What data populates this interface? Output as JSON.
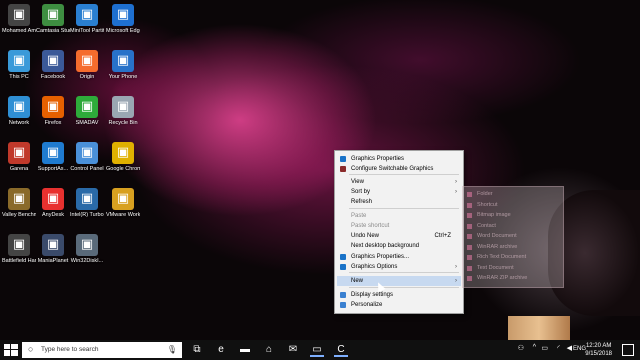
{
  "desktop": {
    "icons": [
      {
        "label": "Mohamed Amr Diaay",
        "icon": "user-folder-icon",
        "color": "#444444"
      },
      {
        "label": "Camtasia Studio 8",
        "icon": "camtasia-icon",
        "color": "#3e8e41"
      },
      {
        "label": "MiniTool Partition...",
        "icon": "minitool-icon",
        "color": "#2a7fd1"
      },
      {
        "label": "Microsoft Edge",
        "icon": "edge-icon",
        "color": "#1e6fd0"
      },
      {
        "label": "This PC",
        "icon": "computer-icon",
        "color": "#3a9ad9"
      },
      {
        "label": "Facebook",
        "icon": "facebook-icon",
        "color": "#3b5998"
      },
      {
        "label": "Origin",
        "icon": "origin-icon",
        "color": "#f56c2d"
      },
      {
        "label": "Your Phone",
        "icon": "phone-icon",
        "color": "#2872c9"
      },
      {
        "label": "Network",
        "icon": "network-icon",
        "color": "#2f8fd4"
      },
      {
        "label": "Firefox",
        "icon": "firefox-icon",
        "color": "#e66000"
      },
      {
        "label": "SMADAV",
        "icon": "smadav-icon",
        "color": "#2eaa3a"
      },
      {
        "label": "Recycle Bin",
        "icon": "recycle-bin-icon",
        "color": "#9aa6b2"
      },
      {
        "label": "Garena",
        "icon": "garena-icon",
        "color": "#c0392b"
      },
      {
        "label": "SupportAs...",
        "icon": "support-assist-icon",
        "color": "#1f7bd0"
      },
      {
        "label": "Control Panel",
        "icon": "control-panel-icon",
        "color": "#4a90d9"
      },
      {
        "label": "Google Chrome",
        "icon": "chrome-icon",
        "color": "#e0b000"
      },
      {
        "label": "Valley Benchma...",
        "icon": "valley-icon",
        "color": "#8a6a2a"
      },
      {
        "label": "AnyDesk",
        "icon": "anydesk-icon",
        "color": "#e8312f"
      },
      {
        "label": "Intel(R) Turbo Boo...",
        "icon": "intel-icon",
        "color": "#2a6aa8"
      },
      {
        "label": "VMware Workstati...",
        "icon": "vmware-icon",
        "color": "#d8a020"
      },
      {
        "label": "Battlefield Hardline",
        "icon": "battlefield-icon",
        "color": "#444444"
      },
      {
        "label": "ManiaPlanet",
        "icon": "maniaplanet-icon",
        "color": "#3a4a6a"
      },
      {
        "label": "Win32DiskI...",
        "icon": "disk-imager-icon",
        "color": "#5a6a7a"
      }
    ]
  },
  "context_menu": {
    "items": [
      {
        "label": "Graphics Properties",
        "icon": "intel-graphics-icon",
        "disabled": false
      },
      {
        "label": "Configure Switchable Graphics",
        "icon": "amd-icon",
        "disabled": false
      },
      {
        "label": "View",
        "arrow": "›",
        "disabled": false
      },
      {
        "label": "Sort by",
        "arrow": "›",
        "disabled": false
      },
      {
        "label": "Refresh",
        "disabled": false
      },
      {
        "label": "Paste",
        "disabled": true
      },
      {
        "label": "Paste shortcut",
        "disabled": true
      },
      {
        "label": "Undo New",
        "shortcut": "Ctrl+Z",
        "disabled": false
      },
      {
        "label": "Next desktop background",
        "disabled": false
      },
      {
        "label": "Graphics Properties...",
        "icon": "intel-graphics-icon",
        "disabled": false
      },
      {
        "label": "Graphics Options",
        "icon": "intel-graphics-icon",
        "arrow": "›",
        "disabled": false
      },
      {
        "label": "New",
        "arrow": "›",
        "disabled": false,
        "highlighted": true
      },
      {
        "label": "Display settings",
        "icon": "display-icon",
        "disabled": false
      },
      {
        "label": "Personalize",
        "icon": "personalize-icon",
        "disabled": false
      }
    ]
  },
  "submenu_new": {
    "items": [
      {
        "label": "Folder"
      },
      {
        "label": "Shortcut"
      },
      {
        "label": "Bitmap image"
      },
      {
        "label": "Contact"
      },
      {
        "label": "Word Document"
      },
      {
        "label": "WinRAR archive"
      },
      {
        "label": "Rich Text Document"
      },
      {
        "label": "Text Document"
      },
      {
        "label": "WinRAR ZIP archive"
      }
    ]
  },
  "taskbar": {
    "search_placeholder": "Type here to search",
    "apps": [
      {
        "icon": "task-view-icon",
        "glyph": "⧉"
      },
      {
        "icon": "edge-icon",
        "glyph": "e"
      },
      {
        "icon": "file-explorer-icon",
        "glyph": "▬"
      },
      {
        "icon": "store-icon",
        "glyph": "⌂"
      },
      {
        "icon": "mail-icon",
        "glyph": "✉"
      },
      {
        "icon": "photos-icon",
        "glyph": "▭"
      },
      {
        "icon": "camtasia-icon",
        "glyph": "C"
      }
    ],
    "language": "ENG",
    "time": "12:20 AM",
    "date": "9/15/2018"
  },
  "colors": {
    "accent": "#c7d9f0",
    "taskbar": "#101010"
  }
}
